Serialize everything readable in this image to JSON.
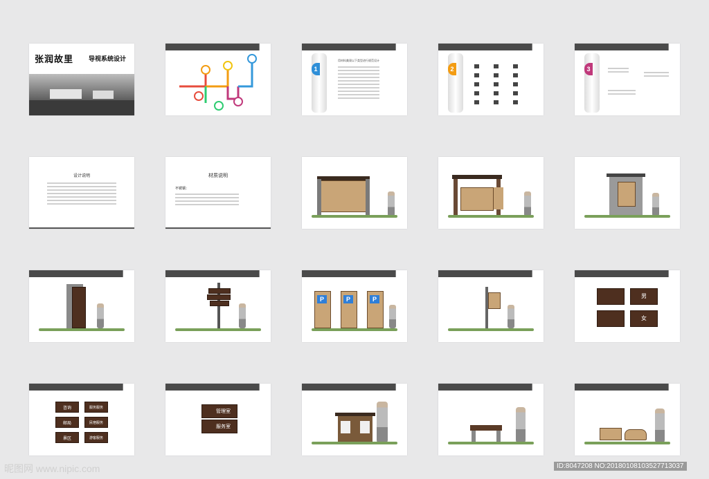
{
  "cover": {
    "title_main": "张润故里",
    "title_sub": "导视系统设计"
  },
  "slide_texts": {
    "design_title": "设计说明",
    "material_title": "材质说明",
    "material_sub": "不锈钢：",
    "slide3_heading": "用材料美观以下类型进行规范设计",
    "num1": "1",
    "num2": "2",
    "num3": "3"
  },
  "toilet_labels": {
    "men": "男",
    "women": "女"
  },
  "wood_signs": [
    "咨询",
    "服务服务",
    "邮局",
    "民宿服务",
    "景区",
    "游客服务"
  ],
  "room_signs": {
    "top": "管理室",
    "bottom": "服务室"
  },
  "watermark": {
    "left": "昵图网 www.nipic.com",
    "right": "ID:8047208 NO:20180108103527713037"
  },
  "colors": {
    "bar": "#4a4a4a",
    "wood": "#4e2f1f",
    "grass": "#7aa05a",
    "c1": "#e74c3c",
    "c2": "#f39c12",
    "c3": "#27ae60",
    "c4": "#3498db",
    "c5": "#c0397b"
  }
}
